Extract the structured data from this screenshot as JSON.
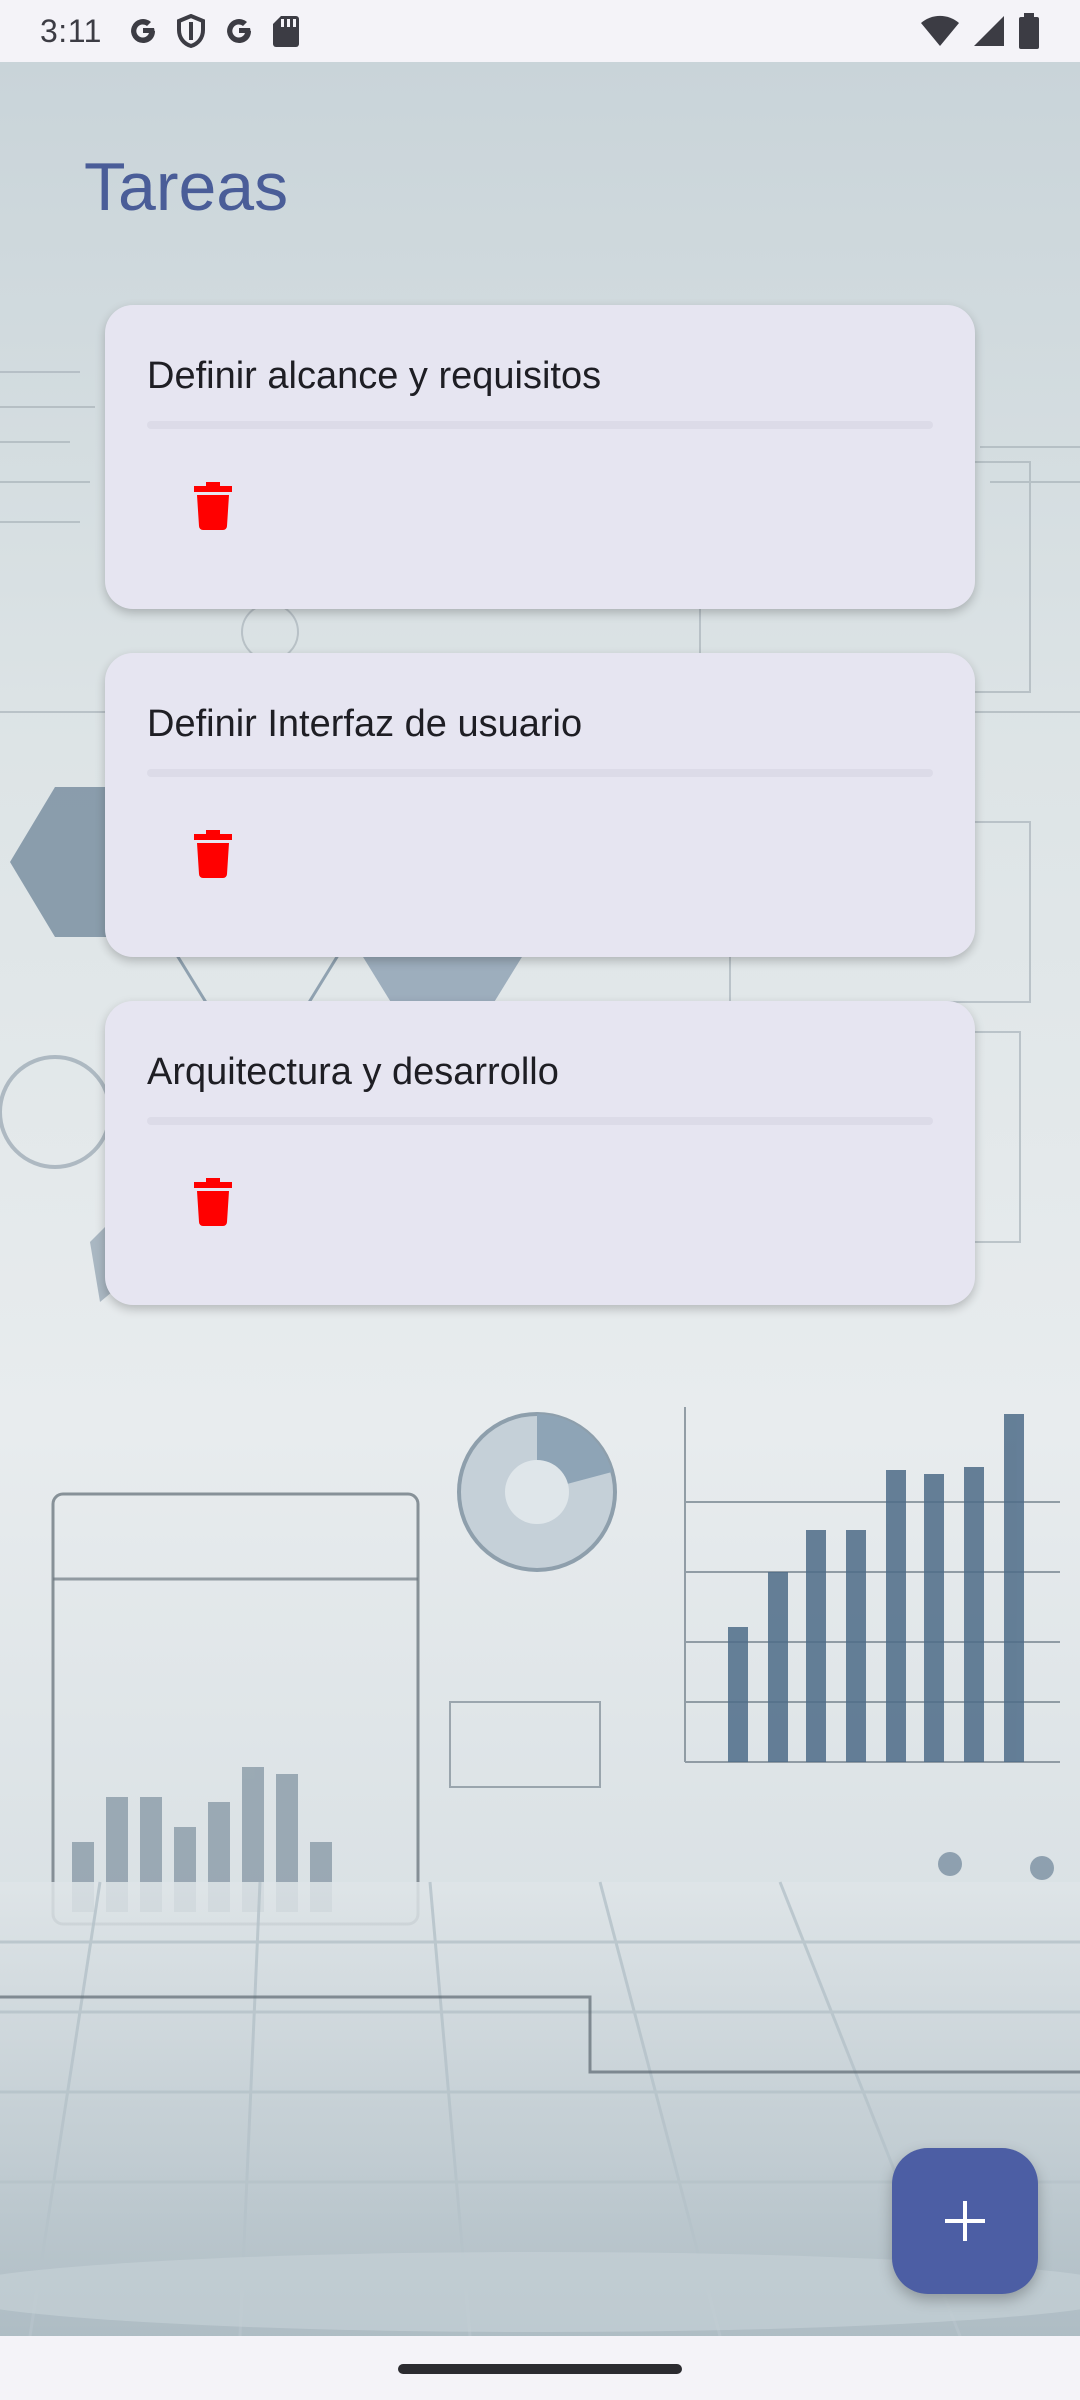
{
  "status_bar": {
    "time": "3:11",
    "left_icons": [
      "google-icon",
      "shield-icon",
      "google-icon",
      "sd-card-icon"
    ],
    "right_icons": [
      "wifi-icon",
      "signal-icon",
      "battery-icon"
    ]
  },
  "page": {
    "title": "Tareas"
  },
  "tasks": [
    {
      "title": "Definir alcance y requisitos"
    },
    {
      "title": "Definir Interfaz de usuario"
    },
    {
      "title": "Arquitectura y desarrollo"
    }
  ],
  "colors": {
    "accent": "#4c5ea4",
    "title": "#4a5d98",
    "card": "#e6e5f1",
    "delete": "#ff0000"
  },
  "fab": {
    "icon": "plus-icon"
  }
}
